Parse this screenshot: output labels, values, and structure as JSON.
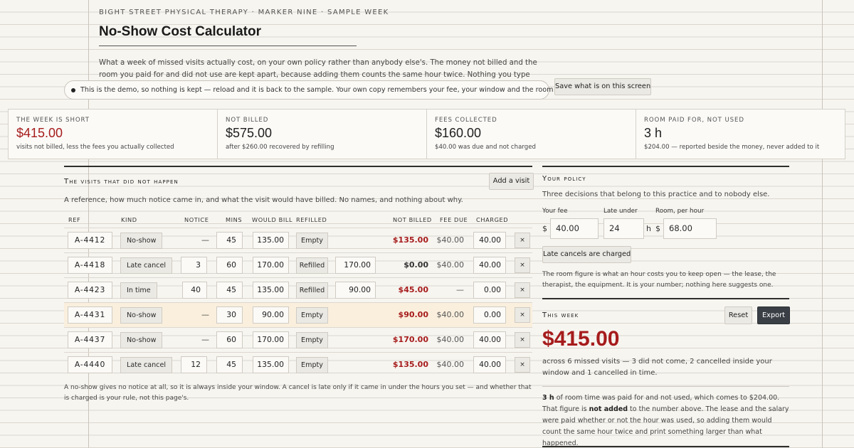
{
  "header": {
    "kicker": "BIGHT STREET PHYSICAL THERAPY · MARKER NINE · SAMPLE WEEK",
    "title": "No-Show Cost Calculator",
    "intro": "What a week of missed visits actually cost, on your own policy rather than anybody else's. The money not billed and the room you paid for and did not use are kept apart, because adding them counts the same hour twice. Nothing you type leaves this page."
  },
  "demo_notice": "This is the demo, so nothing is kept — reload and it is back to the sample. Your own copy remembers your fee, your window and the room cost.",
  "save_button": "Save what is on this screen",
  "stats": [
    {
      "label": "THE WEEK IS SHORT",
      "value": "$415.00",
      "sub": "visits not billed, less the fees you actually collected"
    },
    {
      "label": "NOT BILLED",
      "value": "$575.00",
      "sub": "after $260.00 recovered by refilling"
    },
    {
      "label": "FEES COLLECTED",
      "value": "$160.00",
      "sub": "$40.00 was due and not charged"
    },
    {
      "label": "ROOM PAID FOR, NOT USED",
      "value": "3 h",
      "sub": "$204.00 — reported beside the money, never added to it"
    }
  ],
  "visits": {
    "title": "The visits that did not happen",
    "subtitle": "A reference, how much notice came in, and what the visit would have billed. No names, and nothing about why.",
    "add_button": "Add a visit",
    "columns": {
      "ref": "REF",
      "kind": "KIND",
      "notice": "NOTICE",
      "mins": "MINS",
      "bill": "WOULD BILL",
      "refilled": "REFILLED",
      "not_billed": "NOT BILLED",
      "fee_due": "FEE DUE",
      "charged": "CHARGED"
    },
    "rows": [
      {
        "ref": "A-4412",
        "kind": "No-show",
        "notice": "—",
        "mins": "45",
        "bill": "135.00",
        "fill": "Empty",
        "recovered": "",
        "not_billed": "$135.00",
        "fee_due": "$40.00",
        "charged": "40.00",
        "remove": "×"
      },
      {
        "ref": "A-4418",
        "kind": "Late cancel",
        "notice": "3",
        "mins": "60",
        "bill": "170.00",
        "fill": "Refilled",
        "recovered": "170.00",
        "not_billed": "$0.00",
        "fee_due": "$40.00",
        "charged": "40.00",
        "remove": "×"
      },
      {
        "ref": "A-4423",
        "kind": "In time",
        "notice": "40",
        "mins": "45",
        "bill": "135.00",
        "fill": "Refilled",
        "recovered": "90.00",
        "not_billed": "$45.00",
        "fee_due": "—",
        "charged": "0.00",
        "remove": "×"
      },
      {
        "ref": "A-4431",
        "kind": "No-show",
        "notice": "—",
        "mins": "30",
        "bill": "90.00",
        "fill": "Empty",
        "recovered": "",
        "not_billed": "$90.00",
        "fee_due": "$40.00",
        "charged": "0.00",
        "remove": "×"
      },
      {
        "ref": "A-4437",
        "kind": "No-show",
        "notice": "—",
        "mins": "60",
        "bill": "170.00",
        "fill": "Empty",
        "recovered": "",
        "not_billed": "$170.00",
        "fee_due": "$40.00",
        "charged": "40.00",
        "remove": "×"
      },
      {
        "ref": "A-4440",
        "kind": "Late cancel",
        "notice": "12",
        "mins": "45",
        "bill": "135.00",
        "fill": "Empty",
        "recovered": "",
        "not_billed": "$135.00",
        "fee_due": "$40.00",
        "charged": "40.00",
        "remove": "×"
      }
    ],
    "footnote": "A no-show gives no notice at all, so it is always inside your window. A cancel is late only if it came in under the hours you set — and whether that is charged is your rule, not this page's."
  },
  "policy": {
    "title": "Your policy",
    "subtitle": "Three decisions that belong to this practice and to nobody else.",
    "fee_label": "Your fee",
    "fee_prefix": "$",
    "fee_value": "40.00",
    "late_label": "Late under",
    "late_value": "24",
    "late_suffix": "h",
    "room_label": "Room, per hour",
    "room_prefix": "$",
    "room_value": "68.00",
    "toggle": "Late cancels are charged",
    "room_note": "The room figure is what an hour costs you to keep open — the lease, the therapist, the equipment. It is your number; nothing here suggests one."
  },
  "week": {
    "title": "This week",
    "reset": "Reset",
    "export": "Export",
    "total": "$415.00",
    "summary": "across 6 missed visits — 3 did not come, 2 cancelled inside your window and 1 cancelled in time.",
    "room_hours": "3 h",
    "room_text_1": "of room time was paid for and not used, which comes to $204.00. That figure is",
    "room_not_added": "not added",
    "room_text_2": "to the number above. The lease and the salary were paid whether or not the hour was used, so adding them would count the same hour twice and print something larger than what happened."
  },
  "colors": {
    "accent_red": "#a61c1c",
    "highlight_row": "#faefdd",
    "dark_button": "#3a3f46"
  }
}
